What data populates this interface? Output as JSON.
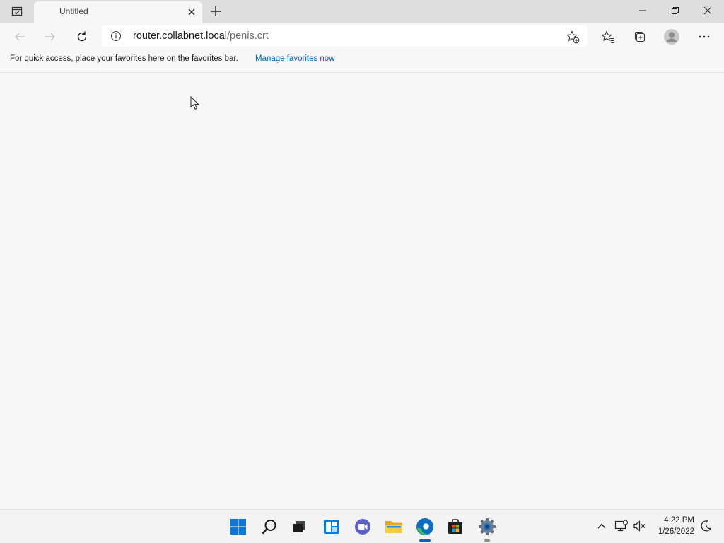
{
  "tab": {
    "title": "Untitled"
  },
  "address_bar": {
    "host": "router.collabnet.local",
    "path": "/penis.crt"
  },
  "favorites_bar": {
    "message": "For quick access, place your favorites here on the favorites bar.",
    "link": "Manage favorites now"
  },
  "taskbar": {
    "apps": [
      "start-icon",
      "search-icon",
      "task-view-icon",
      "widgets-icon",
      "chat-icon",
      "file-explorer-icon",
      "edge-icon",
      "store-icon",
      "settings-icon"
    ],
    "active_app": "edge-icon"
  },
  "clock": {
    "time": "4:22 PM",
    "date": "1/26/2022"
  },
  "colors": {
    "accent": "#0067c0",
    "link": "#0b5cad",
    "edge_blue": "#0c6dc2",
    "edge_green": "#35c15b"
  }
}
